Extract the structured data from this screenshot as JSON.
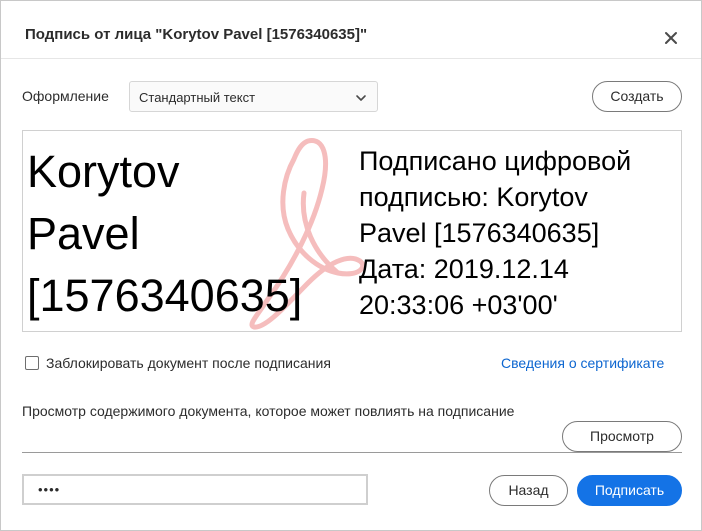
{
  "dialog": {
    "title": "Подпись от лица \"Korytov Pavel [1576340635]\"",
    "close_icon": "close-icon"
  },
  "appearance": {
    "label": "Оформление",
    "selected": "Стандартный текст",
    "create_button": "Создать"
  },
  "signature_preview": {
    "name_lines": [
      "Korytov",
      "Pavel",
      "[1576340635]"
    ],
    "detail_lines": [
      "Подписано цифровой",
      "подписью: Korytov",
      "Pavel [1576340635]",
      "Дата: 2019.12.14",
      "20:33:06 +03'00'"
    ],
    "watermark_icon": "acrobat-logo-watermark",
    "watermark_color": "#f2a7a7"
  },
  "options": {
    "lock_document_label": "Заблокировать документ после подписания",
    "lock_document_checked": false,
    "certificate_details_link": "Сведения о сертификате"
  },
  "document_preview": {
    "note": "Просмотр содержимого документа, которое может повлиять на подписание",
    "preview_button": "Просмотр"
  },
  "footer": {
    "password_value": "••••",
    "back_button": "Назад",
    "sign_button": "Подписать"
  },
  "colors": {
    "accent": "#1473e6",
    "link": "#0d66d0"
  }
}
